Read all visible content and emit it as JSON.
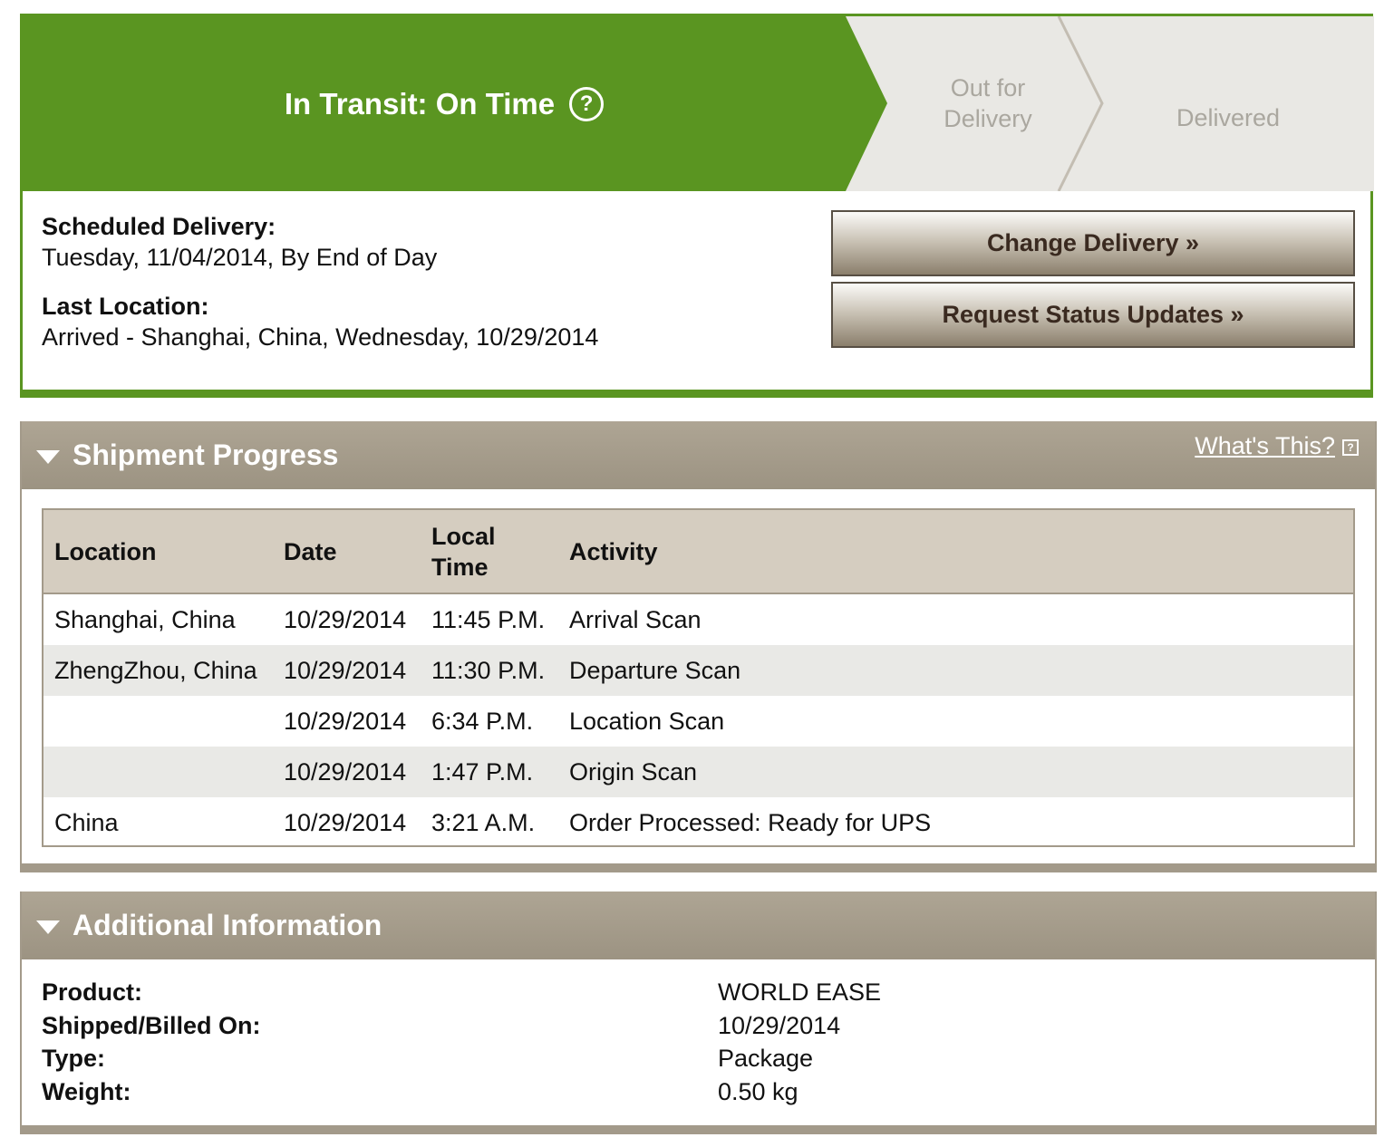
{
  "status": {
    "active_step": "In Transit: On Time",
    "steps": [
      "Out for\nDelivery",
      "Delivered"
    ],
    "colors": {
      "active": "#5a9521",
      "inactive": "#e9e8e4",
      "inactive_text": "#aaa79f"
    }
  },
  "delivery": {
    "scheduled_label": "Scheduled Delivery:",
    "scheduled_value": "Tuesday, 11/04/2014, By End of Day",
    "last_location_label": "Last Location:",
    "last_location_value": "Arrived - Shanghai, China, Wednesday, 10/29/2014"
  },
  "buttons": {
    "change_delivery": "Change Delivery »",
    "request_updates": "Request Status Updates »"
  },
  "shipment_progress": {
    "title": "Shipment Progress",
    "whats_this": "What's This?",
    "columns": [
      "Location",
      "Date",
      "Local\nTime",
      "Activity"
    ],
    "rows": [
      [
        "Shanghai, China",
        "10/29/2014",
        "11:45 P.M.",
        "Arrival Scan"
      ],
      [
        "ZhengZhou, China",
        "10/29/2014",
        "11:30 P.M.",
        "Departure Scan"
      ],
      [
        "",
        "10/29/2014",
        "6:34 P.M.",
        "Location Scan"
      ],
      [
        "",
        "10/29/2014",
        "1:47 P.M.",
        "Origin Scan"
      ],
      [
        "China",
        "10/29/2014",
        "3:21 A.M.",
        "Order Processed: Ready for UPS"
      ]
    ]
  },
  "additional_info": {
    "title": "Additional Information",
    "items": [
      {
        "label": "Product:",
        "value": "WORLD EASE"
      },
      {
        "label": "Shipped/Billed On:",
        "value": "10/29/2014"
      },
      {
        "label": "Type:",
        "value": "Package"
      },
      {
        "label": "Weight:",
        "value": "0.50 kg"
      }
    ]
  }
}
